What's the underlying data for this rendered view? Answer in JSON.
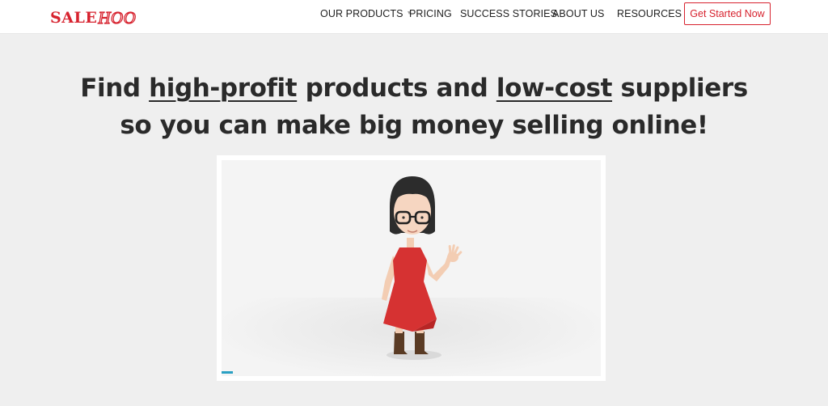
{
  "header": {
    "logo": {
      "part1": "SALE",
      "part2": "HOO"
    },
    "nav": [
      {
        "label": "OUR PRODUCTS",
        "has_dropdown": true
      },
      {
        "label": "PRICING",
        "has_dropdown": false
      },
      {
        "label": "SUCCESS STORIES",
        "has_dropdown": false
      },
      {
        "label": "ABOUT US",
        "has_dropdown": false
      },
      {
        "label": "RESOURCES",
        "has_dropdown": true
      }
    ],
    "cta_label": "Get Started Now"
  },
  "hero": {
    "line1_a": "Find ",
    "line1_u1": "high-profit",
    "line1_b": " products and ",
    "line1_u2": "low-cost",
    "line1_c": " suppliers",
    "line2": "so you can make big money selling online!"
  },
  "video": {
    "progress": 0.03
  },
  "colors": {
    "brand_red": "#d7232f",
    "progress_blue": "#2aa0c3",
    "dress_red": "#d63232",
    "page_background": "#efefef"
  },
  "icons": [
    "dropdown-caret-icon"
  ]
}
